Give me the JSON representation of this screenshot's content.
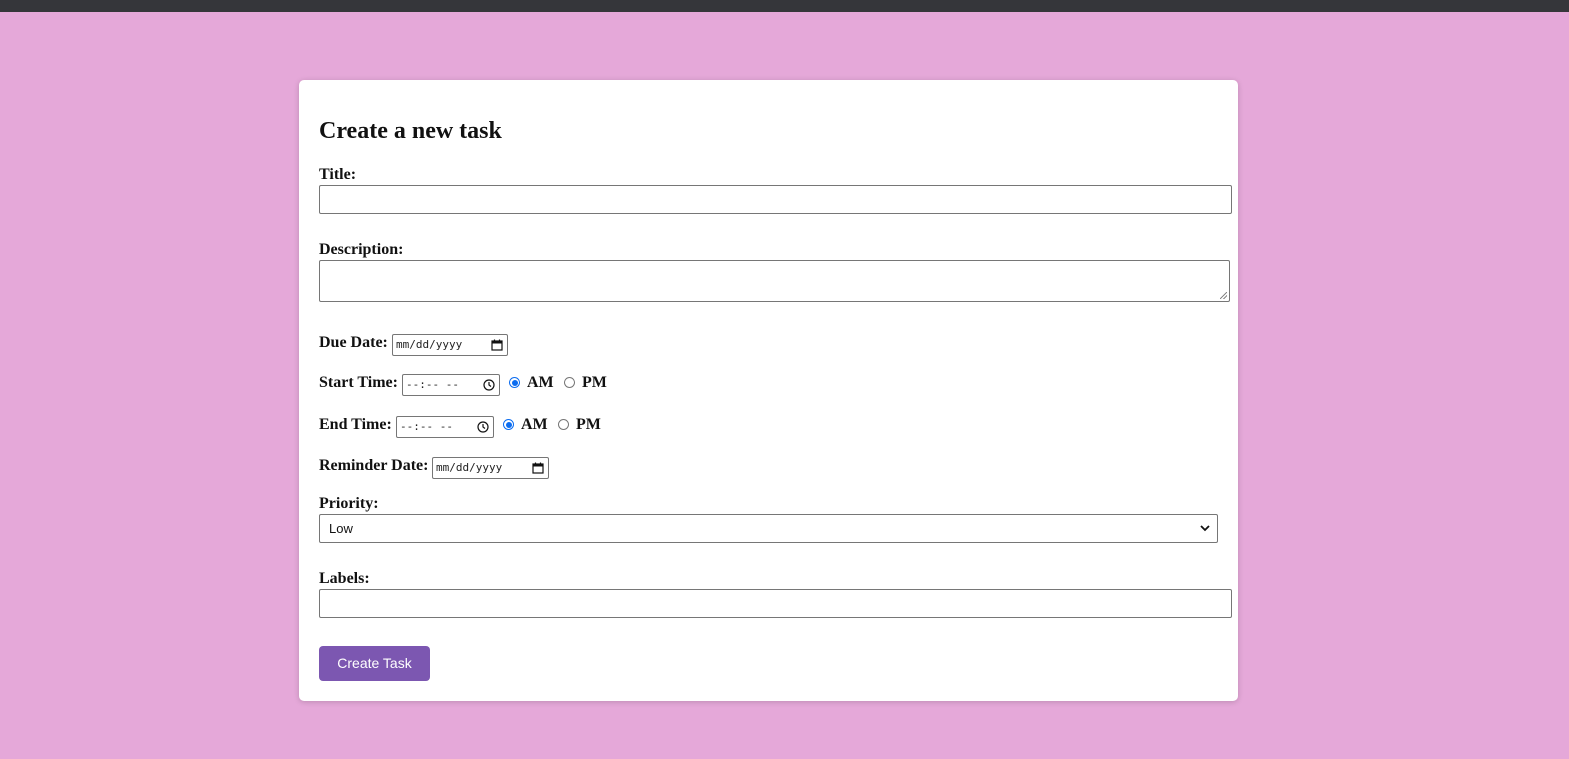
{
  "form": {
    "heading": "Create a new task",
    "title_label": "Title:",
    "title_value": "",
    "description_label": "Description:",
    "description_value": "",
    "due_date_label": "Due Date:",
    "due_date_placeholder": "mm/dd/yyyy",
    "start_time_label": "Start Time:",
    "start_time_placeholder": "--:-- --",
    "start_am_label": "AM",
    "start_pm_label": "PM",
    "start_selected": "AM",
    "end_time_label": "End Time:",
    "end_time_placeholder": "--:-- --",
    "end_am_label": "AM",
    "end_pm_label": "PM",
    "end_selected": "AM",
    "reminder_date_label": "Reminder Date:",
    "reminder_date_placeholder": "mm/dd/yyyy",
    "priority_label": "Priority:",
    "priority_selected": "Low",
    "labels_label": "Labels:",
    "labels_value": "",
    "submit_label": "Create Task"
  },
  "icons": {
    "date_icon": "calendar-icon",
    "time_icon": "clock-icon",
    "select_icon": "chevron-down-icon"
  },
  "colors": {
    "page_background": "#e5a8d9",
    "card_background": "#ffffff",
    "button_background": "#7c57b1",
    "radio_checked": "#0b6cf0",
    "topbar": "#35363a"
  }
}
